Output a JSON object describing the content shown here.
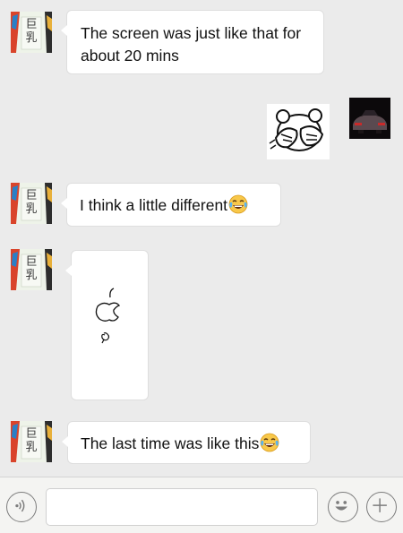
{
  "avatar": {
    "line1": "巨",
    "line2": "乳"
  },
  "messages": [
    {
      "text": "The screen was just like that for about 20 mins"
    },
    {
      "text": "I think a little different"
    },
    {
      "text": "The last time was like this"
    }
  ],
  "icons": {
    "voice": "voice-icon",
    "emoji": "smiley-icon",
    "more": "plus-icon",
    "laugh": "laughing-tears-emoji"
  },
  "colors": {
    "background": "#ebebeb",
    "bubble": "#ffffff",
    "inputbar": "#f4f4f2"
  }
}
